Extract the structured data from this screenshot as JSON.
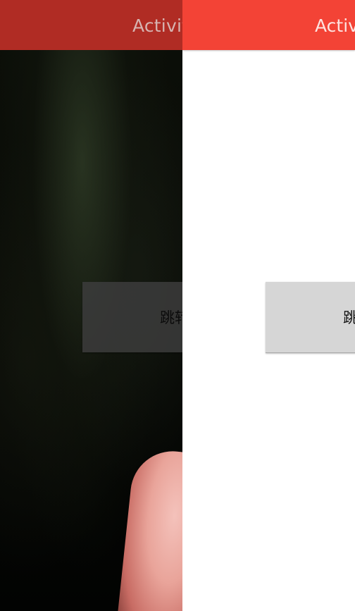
{
  "left_activity": {
    "toolbar": {
      "title": "Activit"
    },
    "button": {
      "label": "跳转"
    }
  },
  "right_activity": {
    "toolbar": {
      "title": "Activ"
    },
    "button": {
      "label": "跳"
    }
  },
  "colors": {
    "left_toolbar": "#b02c24",
    "right_toolbar": "#f34336",
    "right_background": "#ffffff",
    "button_gray": "#d6d6d6"
  }
}
